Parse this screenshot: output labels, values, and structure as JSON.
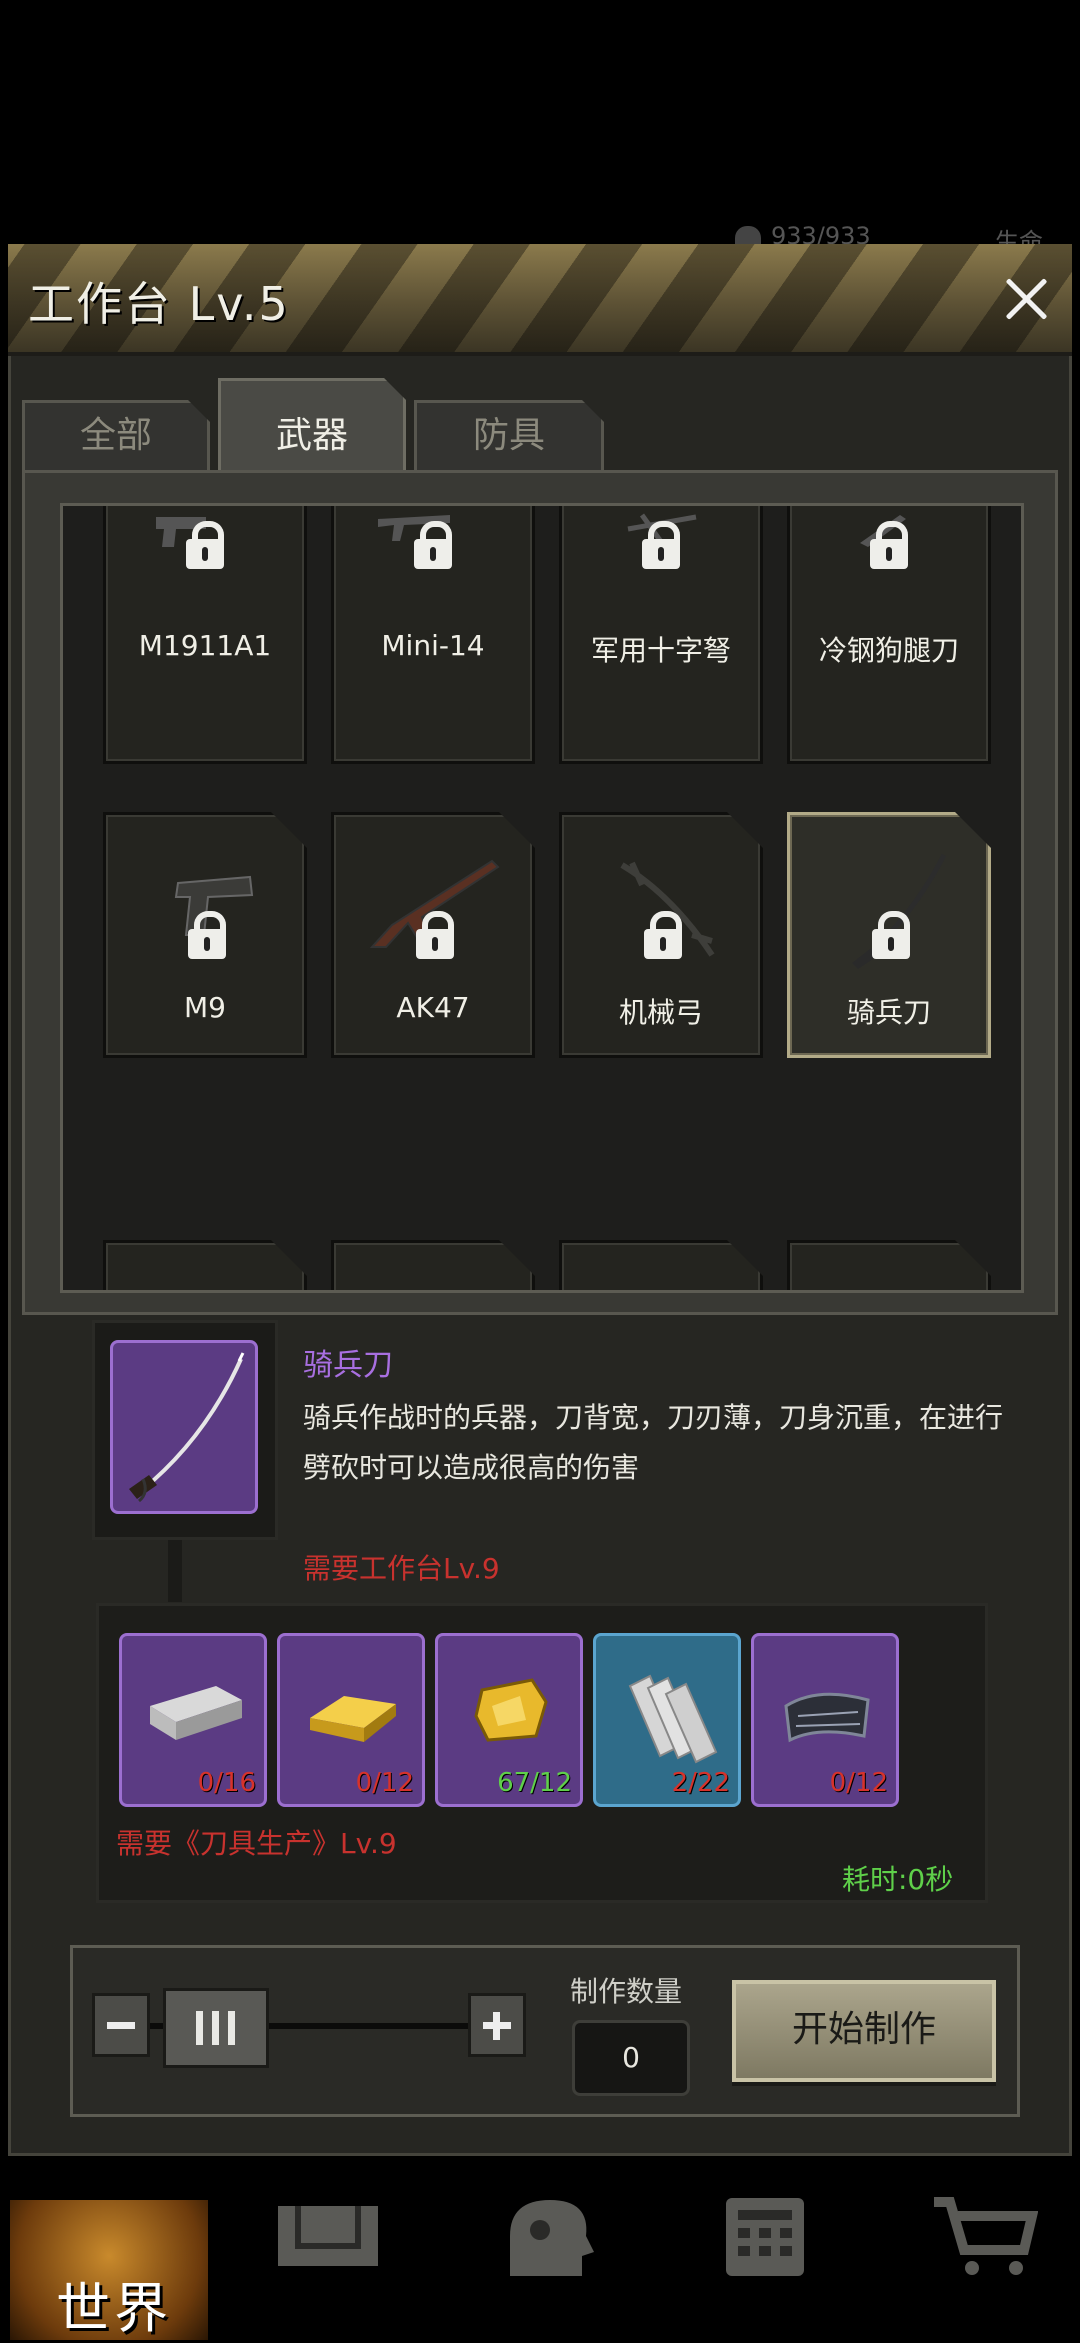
{
  "status": {
    "hp": "933/933",
    "hp_label": "生命"
  },
  "header": {
    "title": "工作台 Lv.5"
  },
  "tabs": [
    {
      "label": "全部"
    },
    {
      "label": "武器"
    },
    {
      "label": "防具"
    }
  ],
  "recipes": [
    {
      "name": "M1911A1",
      "locked": true
    },
    {
      "name": "Mini-14",
      "locked": true
    },
    {
      "name": "军用十字弩",
      "locked": true
    },
    {
      "name": "冷钢狗腿刀",
      "locked": true
    },
    {
      "name": "M9",
      "locked": true
    },
    {
      "name": "AK47",
      "locked": true
    },
    {
      "name": "机械弓",
      "locked": true
    },
    {
      "name": "骑兵刀",
      "locked": true,
      "selected": true
    }
  ],
  "detail": {
    "name": "骑兵刀",
    "description": "骑兵作战时的兵器，刀背宽，刀刃薄，刀身沉重，在进行劈砍时可以造成很高的伤害",
    "requirement_bench": "需要工作台Lv.9",
    "requirement_skill": "需要《刀具生产》Lv.9",
    "time": "耗时:0秒"
  },
  "materials": [
    {
      "icon": "steel-beam-icon",
      "count": "0/16",
      "enough": false
    },
    {
      "icon": "gold-bar-icon",
      "count": "0/12",
      "enough": false
    },
    {
      "icon": "gold-ore-icon",
      "count": "67/12",
      "enough": true
    },
    {
      "icon": "steel-plate-icon",
      "count": "2/22",
      "enough": false
    },
    {
      "icon": "carbon-fiber-icon",
      "count": "0/12",
      "enough": false
    }
  ],
  "craft": {
    "quantity_label": "制作数量",
    "quantity": "0",
    "start_label": "开始制作"
  },
  "nav": {
    "world": "世界"
  },
  "colors": {
    "rare_purple": "#9c6fd0",
    "uncommon_blue": "#5ba5cf",
    "missing_red": "#c8322e",
    "ok_green": "#5fd04a"
  }
}
